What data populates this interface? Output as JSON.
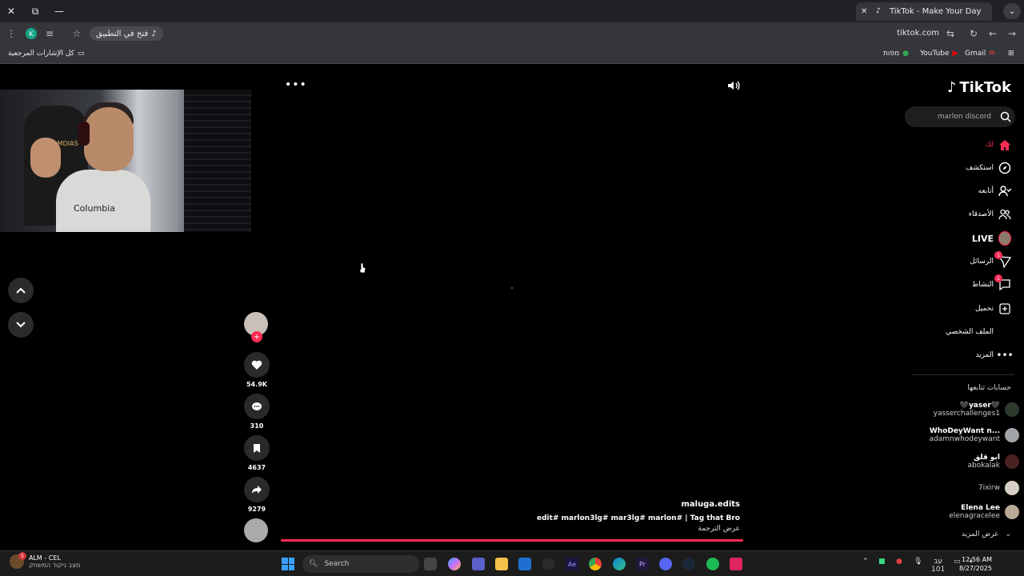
{
  "browser": {
    "tab_title": "TikTok - Make Your Day",
    "url": "tiktok.com",
    "open_in_app": "فتح في التطبيق",
    "bookmarks": {
      "all_bookmarks": "كل الإشارات المرجعية",
      "gmail": "Gmail",
      "youtube": "YouTube",
      "maps": "מפות"
    },
    "profile_initial": "K"
  },
  "player": {
    "counts": {
      "likes": "54.9K",
      "comments": "310",
      "saves": "4637",
      "shares": "9279"
    },
    "author": "maluga.edits",
    "description": "edit#  marlon3lg#  mar3lg#  marlon# | Tag that Bro",
    "see_translation": "عرض الترجمة",
    "progress_fraction": 1.0
  },
  "webcam": {
    "shirt_brand": "Columbia",
    "chair_logo": "GAMDIAS"
  },
  "sidebar": {
    "logo": "TikTok",
    "search_placeholder": "marlon discord",
    "nav": {
      "for_you": "لك",
      "explore": "استكشف",
      "following": "أتابعه",
      "friends": "الأصدقاء",
      "live": "LIVE",
      "messages": "الرسائل",
      "activity": "النشاط",
      "upload": "تحميل",
      "profile": "الملف الشخصي",
      "more": "المزيد"
    },
    "badges": {
      "messages": "1",
      "activity": "1"
    },
    "following_title": "حسابات تتابعها",
    "accounts": [
      {
        "name": "🖤yaser🖤",
        "handle": "yasserchallenges1"
      },
      {
        "name": "WhoDeyWant n...",
        "handle": "adamnwhodeywant"
      },
      {
        "name": "ابو قلق",
        "handle": "abokalak"
      },
      {
        "name": "",
        "handle": "7ixirw"
      },
      {
        "name": "Elena Lee",
        "handle": "elenagracelee"
      }
    ],
    "see_more": "عرض المزيد"
  },
  "taskbar": {
    "weather_line1": "ALM - CEL",
    "weather_line2": "מצב ניקוד המשחק",
    "weather_badge": "5",
    "search": "Search",
    "time": "12:56 AM",
    "date": "8/27/2025",
    "lang": "עב",
    "battery": "101"
  },
  "colors": {
    "accent": "#fe2c55",
    "panel": "#1e1e1e"
  }
}
